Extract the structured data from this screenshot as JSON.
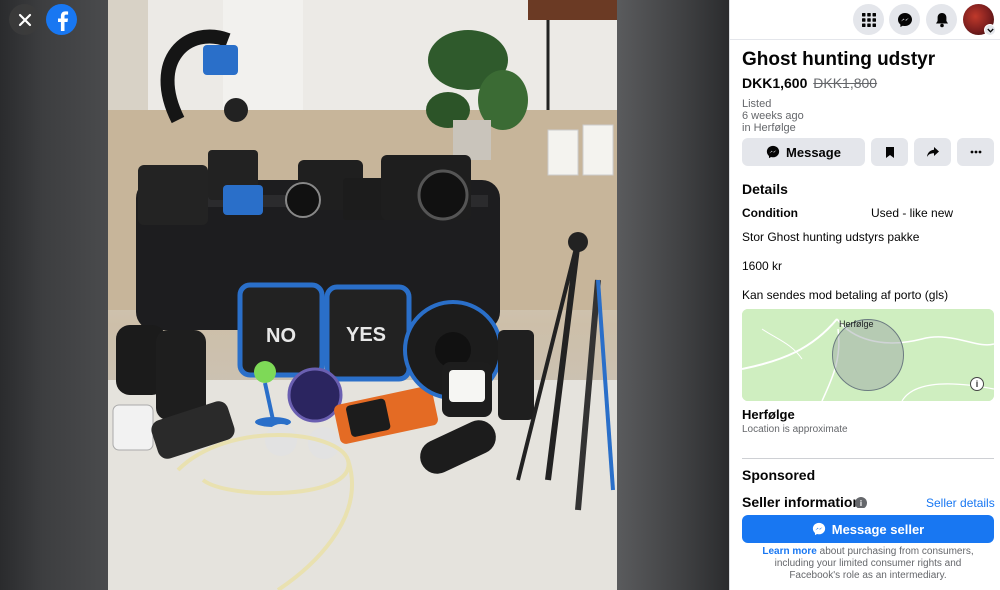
{
  "viewer": {
    "close_icon": "close-icon",
    "logo_icon": "facebook-logo"
  },
  "topbar": {
    "menu_icon": "grid-menu-icon",
    "messenger_icon": "messenger-icon",
    "notifications_icon": "bell-icon",
    "avatar_caret_icon": "chevron-down-icon"
  },
  "listing": {
    "title": "Ghost hunting udstyr",
    "price": "DKK1,600",
    "old_price": "DKK1,800",
    "listed_label": "Listed",
    "listed_time": "6 weeks ago",
    "listed_location": "in Herfølge"
  },
  "actions": {
    "message_label": "Message",
    "save_icon": "bookmark-icon",
    "share_icon": "share-icon",
    "more_icon": "more-icon"
  },
  "details": {
    "heading": "Details",
    "condition_label": "Condition",
    "condition_value": "Used - like new",
    "description_lines": [
      "Stor Ghost hunting udstyrs pakke",
      "1600 kr",
      "Kan sendes mod betaling af porto (gls)"
    ]
  },
  "map": {
    "place_label": "Herfølge",
    "info_glyph": "i"
  },
  "location": {
    "name": "Herfølge",
    "note": "Location is approximate"
  },
  "sponsored": {
    "heading": "Sponsored"
  },
  "seller": {
    "heading": "Seller information",
    "info_glyph": "i",
    "details_link": "Seller details"
  },
  "footer": {
    "message_seller_label": "Message seller",
    "learn_more": "Learn more",
    "legal_text": " about purchasing from consumers, including your limited consumer rights and Facebook's role as an intermediary."
  },
  "colors": {
    "accent": "#1877f2",
    "muted": "#65676b",
    "button_bg": "#e4e6eb"
  }
}
